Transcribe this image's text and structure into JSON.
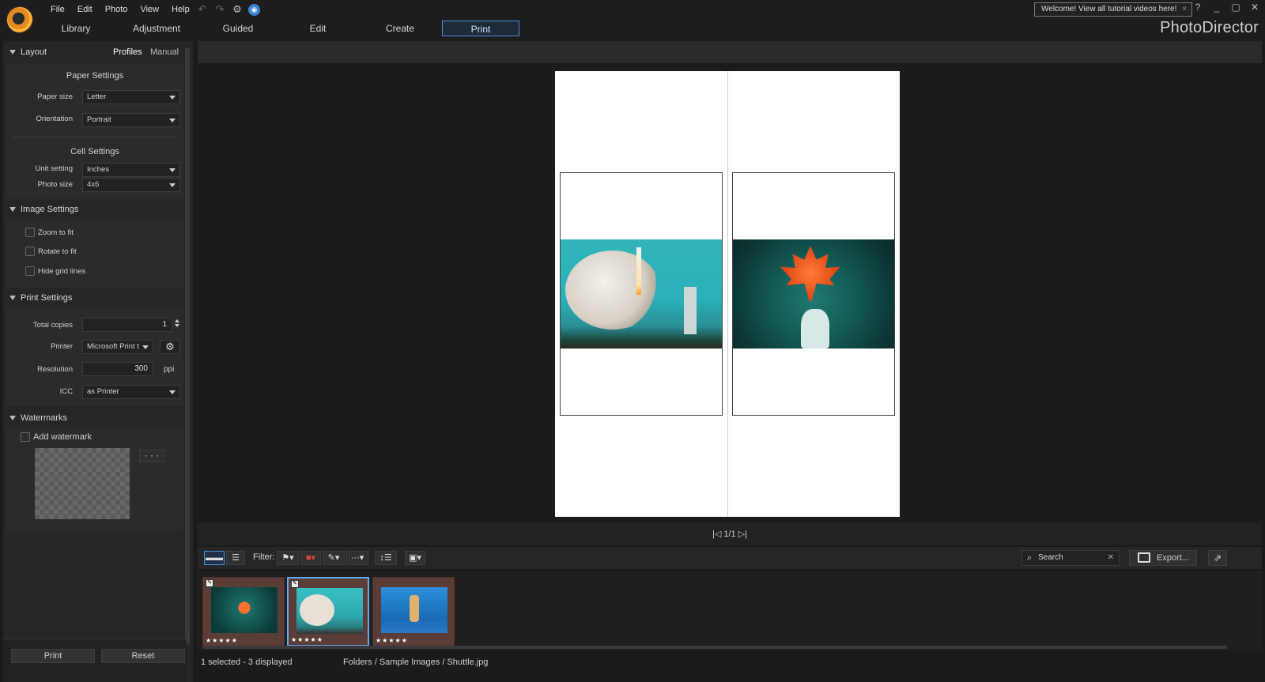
{
  "menu": [
    "File",
    "Edit",
    "Photo",
    "View",
    "Help"
  ],
  "quick_icons": [
    "undo-icon",
    "redo-icon",
    "settings-icon",
    "notification-icon"
  ],
  "welcome": {
    "text": "Welcome! View all tutorial videos here!",
    "close": "×"
  },
  "window_controls": [
    "?",
    "_",
    "▢",
    "✕"
  ],
  "tabs": [
    "Library",
    "Adjustment",
    "Guided",
    "Edit",
    "Create",
    "Print"
  ],
  "active_tab": "Print",
  "brand": "PhotoDirector",
  "left_panel": {
    "layout": {
      "title": "Layout",
      "profiles": "Profiles",
      "manual": "Manual",
      "paper_settings": "Paper Settings",
      "paper_size_label": "Paper size",
      "paper_size": "Letter",
      "orientation_label": "Orientation",
      "orientation": "Portrait",
      "cell_settings": "Cell Settings",
      "unit_label": "Unit setting",
      "unit": "Inches",
      "photo_size_label": "Photo size",
      "photo_size": "4x6"
    },
    "image_settings": {
      "title": "Image Settings",
      "zoom": "Zoom to fit",
      "rotate": "Rotate to fit",
      "hide_grid": "Hide grid lines"
    },
    "print_settings": {
      "title": "Print Settings",
      "copies_label": "Total copies",
      "copies": "1",
      "printer_label": "Printer",
      "printer": "Microsoft Print t",
      "resolution_label": "Resolution",
      "resolution": "300",
      "resolution_unit": "ppi",
      "icc_label": "ICC",
      "icc": "as Printer"
    },
    "watermarks": {
      "title": "Watermarks",
      "add": "Add watermark",
      "more": "· · ·"
    },
    "buttons": {
      "print": "Print",
      "reset": "Reset"
    }
  },
  "preview": {
    "pager": "|◁ 1/1 ▷|"
  },
  "filmstrip_tools": {
    "filter_label": "Filter:",
    "search": "Search",
    "export": "Export..."
  },
  "thumbnails": [
    {
      "name": "maple",
      "stars": "★★★★★",
      "selected": false
    },
    {
      "name": "shuttle",
      "stars": "★★★★★",
      "selected": true
    },
    {
      "name": "jump",
      "stars": "★★★★★",
      "selected": false
    }
  ],
  "status": {
    "selection": "1 selected - 3 displayed",
    "path": "Folders / Sample Images / Shuttle.jpg"
  }
}
